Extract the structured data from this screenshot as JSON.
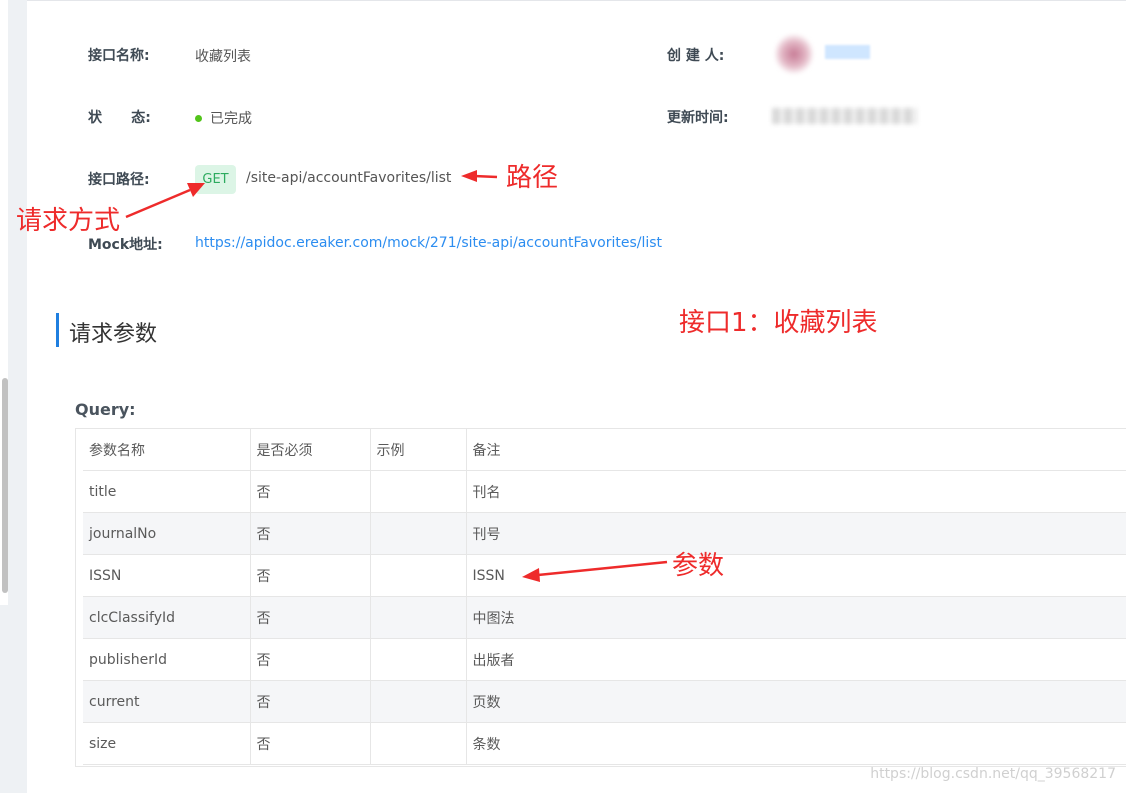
{
  "info": {
    "name_label": "接口名称:",
    "name_value": "收藏列表",
    "creator_label": "创 建 人:",
    "status_label": "状      态:",
    "status_value": "已完成",
    "status_color": "#52c41a",
    "updated_label": "更新时间:",
    "path_label": "接口路径:",
    "method": "GET",
    "path": "/site-api/accountFavorites/list",
    "mock_label": "Mock地址:",
    "mock_url": "https://apidoc.ereaker.com/mock/271/site-api/accountFavorites/list"
  },
  "section_title": "请求参数",
  "query": {
    "label": "Query:",
    "columns": [
      "参数名称",
      "是否必须",
      "示例",
      "备注"
    ],
    "rows": [
      {
        "name": "title",
        "required": "否",
        "example": "",
        "note": "刊名"
      },
      {
        "name": "journalNo",
        "required": "否",
        "example": "",
        "note": "刊号"
      },
      {
        "name": "ISSN",
        "required": "否",
        "example": "",
        "note": "ISSN"
      },
      {
        "name": "clcClassifyId",
        "required": "否",
        "example": "",
        "note": "中图法"
      },
      {
        "name": "publisherId",
        "required": "否",
        "example": "",
        "note": "出版者"
      },
      {
        "name": "current",
        "required": "否",
        "example": "",
        "note": "页数"
      },
      {
        "name": "size",
        "required": "否",
        "example": "",
        "note": "条数"
      }
    ]
  },
  "annotations": {
    "path": "路径",
    "method": "请求方式",
    "interface": "接口1：收藏列表",
    "params": "参数",
    "color": "#ee2b2b"
  },
  "watermark": "https://blog.csdn.net/qq_39568217"
}
